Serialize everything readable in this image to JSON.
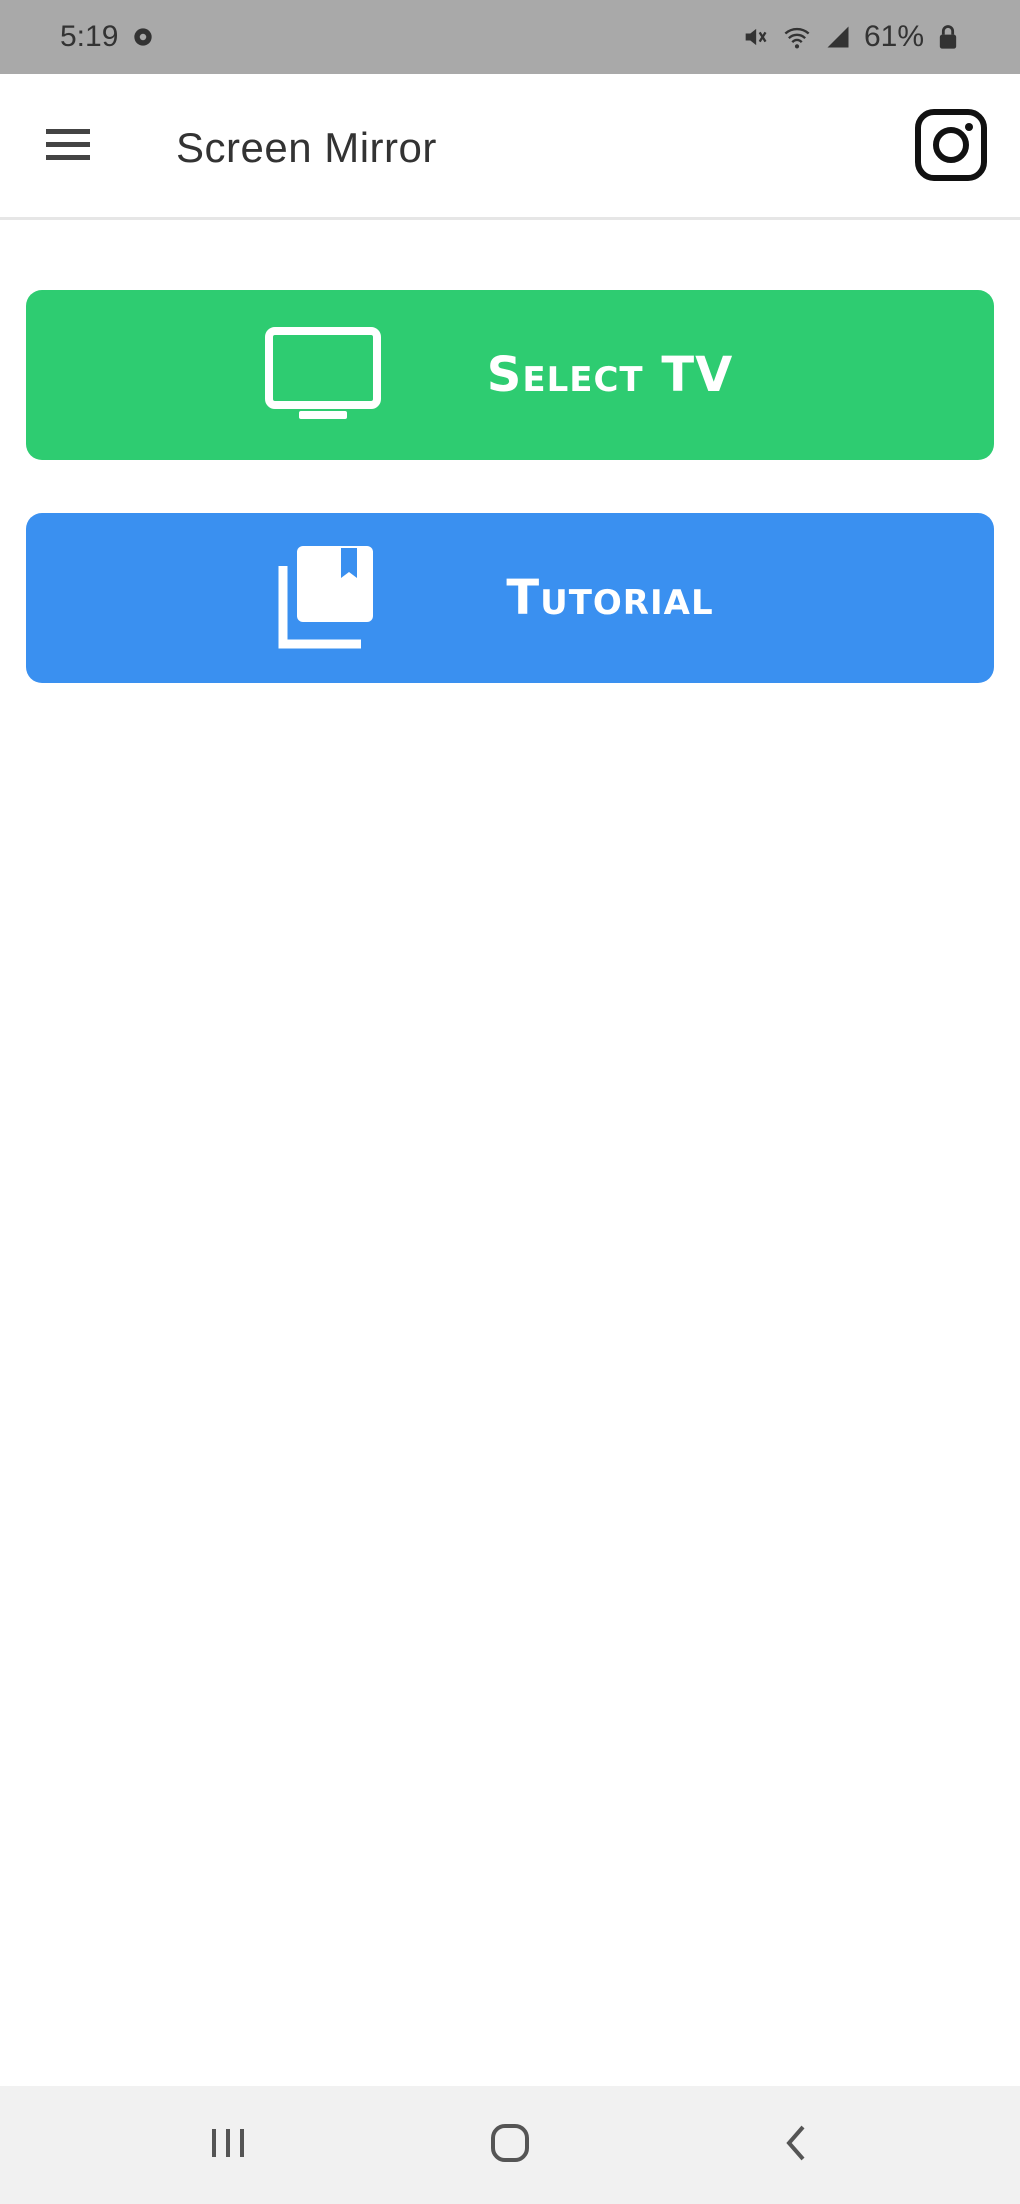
{
  "status_bar": {
    "time": "5:19",
    "battery": "61%",
    "icons": [
      "settings-gear-icon",
      "mute-icon",
      "wifi-icon",
      "signal-icon",
      "battery-lock-icon"
    ]
  },
  "app_bar": {
    "title": "Screen Mirror",
    "menu_icon": "hamburger-menu-icon",
    "action_icon": "instagram-icon"
  },
  "buttons": [
    {
      "label": "Select TV",
      "icon": "tv-monitor-icon",
      "color": "#2ecc71"
    },
    {
      "label": "Tutorial",
      "icon": "library-books-icon",
      "color": "#3a90f0"
    }
  ],
  "nav_bar": {
    "icons": [
      "recent-apps-icon",
      "home-icon",
      "back-icon"
    ]
  },
  "colors": {
    "status_bar_bg": "#a9a9a9",
    "select_tv": "#2ecc71",
    "tutorial": "#3a90f0",
    "nav_bar_bg": "#f1f1f1"
  }
}
